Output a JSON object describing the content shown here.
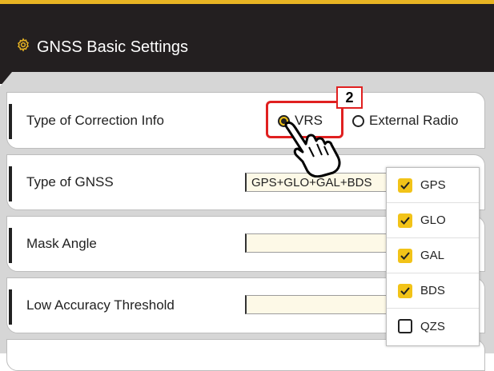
{
  "header": {
    "title": "GNSS Basic Settings",
    "icon": "gear-icon"
  },
  "rows": {
    "correction": {
      "label": "Type of Correction Info"
    },
    "gnss": {
      "label": "Type of GNSS",
      "value": "GPS+GLO+GAL+BDS"
    },
    "mask": {
      "label": "Mask Angle",
      "value": ""
    },
    "threshold": {
      "label": "Low Accuracy Threshold",
      "value": ""
    }
  },
  "correction_options": {
    "vrs": "VRS",
    "external": "External Radio",
    "selected": "VRS"
  },
  "step_badge": "2",
  "gnss_options": [
    {
      "label": "GPS",
      "checked": true
    },
    {
      "label": "GLO",
      "checked": true
    },
    {
      "label": "GAL",
      "checked": true
    },
    {
      "label": "BDS",
      "checked": true
    },
    {
      "label": "QZS",
      "checked": false
    }
  ],
  "colors": {
    "accent": "#f2c318",
    "header": "#231f20",
    "highlight": "#e02020"
  }
}
